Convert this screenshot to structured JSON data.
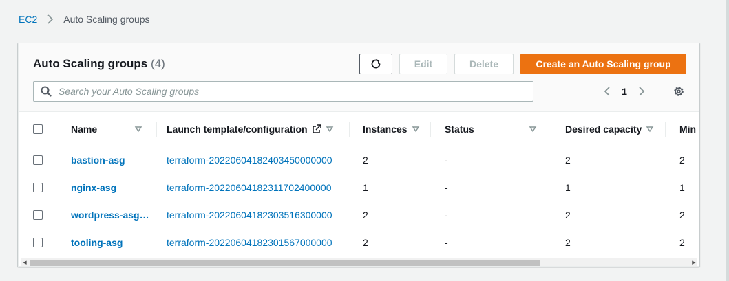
{
  "breadcrumb": {
    "root": "EC2",
    "current": "Auto Scaling groups"
  },
  "panel": {
    "title": "Auto Scaling groups",
    "count": "(4)",
    "buttons": {
      "edit": "Edit",
      "delete": "Delete",
      "create": "Create an Auto Scaling group"
    }
  },
  "search": {
    "placeholder": "Search your Auto Scaling groups",
    "value": ""
  },
  "pagination": {
    "current_page": "1"
  },
  "table": {
    "columns": [
      "Name",
      "Launch template/configuration",
      "Instances",
      "Status",
      "Desired capacity",
      "Min"
    ],
    "rows": [
      {
        "name": "bastion-asg",
        "launch_template": "terraform-20220604182403450000000",
        "instances": "2",
        "status": "-",
        "desired_capacity": "2",
        "min": "2"
      },
      {
        "name": "nginx-asg",
        "launch_template": "terraform-20220604182311702400000",
        "instances": "1",
        "status": "-",
        "desired_capacity": "1",
        "min": "1"
      },
      {
        "name": "wordpress-asg…",
        "launch_template": "terraform-20220604182303516300000",
        "instances": "2",
        "status": "-",
        "desired_capacity": "2",
        "min": "2"
      },
      {
        "name": "tooling-asg",
        "launch_template": "terraform-20220604182301567000000",
        "instances": "2",
        "status": "-",
        "desired_capacity": "2",
        "min": "2"
      }
    ]
  },
  "colors": {
    "link": "#0073bb",
    "primary_button": "#ec7211",
    "page_background": "#f2f3f3"
  },
  "icons": [
    "refresh-icon",
    "search-icon",
    "chevron-left-icon",
    "chevron-right-icon",
    "gear-icon",
    "sort-icon",
    "external-link-icon",
    "chevron-right-breadcrumb-icon"
  ]
}
